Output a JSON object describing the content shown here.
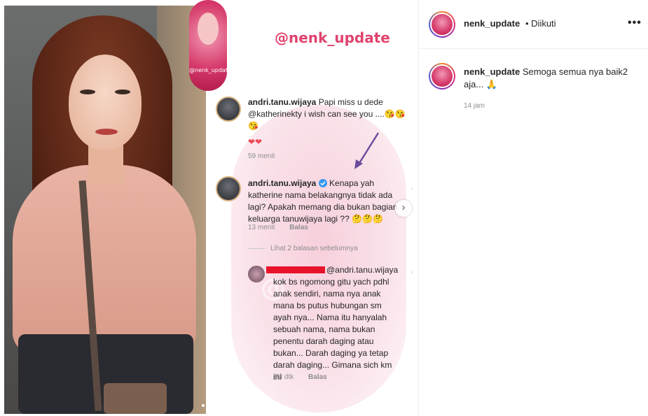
{
  "post": {
    "brand_handle": "@nenk_update",
    "brand_avatar_text": "@nenk_update",
    "watermark": "@",
    "comments": [
      {
        "user": "andri.tanu.wijaya",
        "text": "Papi miss u dede @katherinekty i wish can see you ....😘😘 😘",
        "hearts": "❤❤",
        "time": "59 menit"
      },
      {
        "user": "andri.tanu.wijaya",
        "verified": true,
        "text": "Kenapa yah katherine nama belakangnya tidak ada lagi? Apakah memang dia bukan bagian keluarga tanuwijaya lagi ?? 🤔🤔🤔",
        "time": "13 menit",
        "reply_label": "Balas"
      }
    ],
    "view_replies": "Lihat 2 balasan sebelumnya",
    "reply": {
      "mention": "@andri.tanu.wijaya",
      "text": "kok bs ngomong gitu yach pdhl anak sendiri, nama nya anak mana bs putus hubungan sm ayah nya... Nama itu hanyalah sebuah nama, nama bukan penentu darah daging atau bukan... Darah daging ya tetap darah daging... Gimana sich km ini",
      "time": "53 dtk",
      "reply_label": "Balas"
    },
    "next_icon": "chevron-right-icon",
    "colors": {
      "brand": "#e0436e",
      "redact": "#e8132a",
      "heart": "#ed4956"
    }
  },
  "panel": {
    "username": "nenk_update",
    "follow_status": "• Diikuti",
    "more_icon": "•••",
    "caption_user": "nenk_update",
    "caption_text": "Semoga semua nya baik2 aja... 🙏",
    "timestamp": "14 jam"
  }
}
